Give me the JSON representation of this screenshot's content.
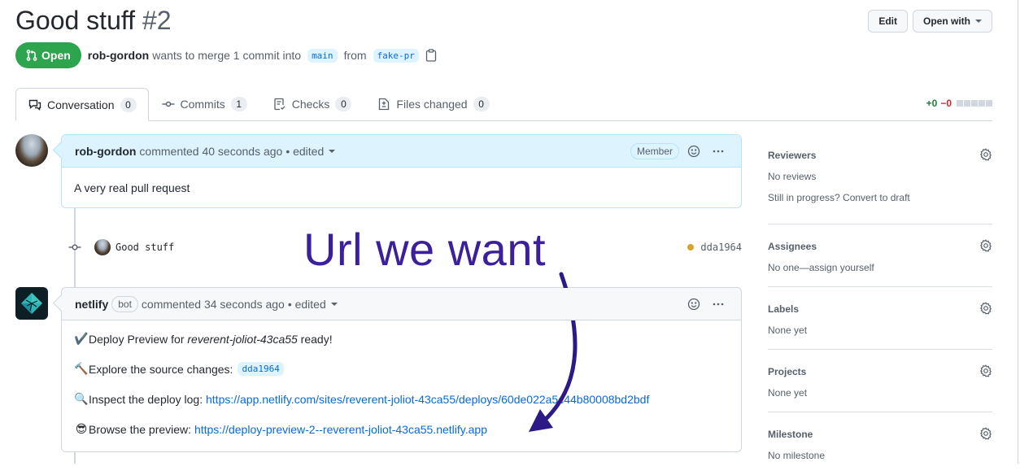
{
  "header": {
    "title": "Good stuff",
    "number": "#2",
    "edit_label": "Edit",
    "open_with_label": "Open with"
  },
  "state": {
    "badge_label": "Open",
    "author": "rob-gordon",
    "merge_text": "wants to merge 1 commit into",
    "base_branch": "main",
    "from_text": "from",
    "head_branch": "fake-pr"
  },
  "tabs": [
    {
      "label": "Conversation",
      "count": "0",
      "icon": "comment-discussion-icon",
      "active": true
    },
    {
      "label": "Commits",
      "count": "1",
      "icon": "git-commit-icon"
    },
    {
      "label": "Checks",
      "count": "0",
      "icon": "checklist-icon"
    },
    {
      "label": "Files changed",
      "count": "0",
      "icon": "file-diff-icon"
    }
  ],
  "diffstat": {
    "additions": "+0",
    "deletions": "−0"
  },
  "comments": [
    {
      "author": "rob-gordon",
      "meta": "commented 40 seconds ago",
      "edited": "• edited",
      "role_badge": "Member",
      "body": "A very real pull request"
    },
    {
      "author": "netlify",
      "bot_badge": "bot",
      "meta": "commented 34 seconds ago",
      "edited": "• edited",
      "lines": [
        {
          "emoji": "✔️",
          "text": "Deploy Preview for ",
          "italic": "reverent-joliot-43ca55",
          "suffix": " ready!"
        },
        {
          "emoji": "🔨",
          "text": "Explore the source changes: ",
          "code": "dda1964"
        },
        {
          "emoji": "🔍",
          "text": "Inspect the deploy log: ",
          "link": "https://app.netlify.com/sites/reverent-joliot-43ca55/deploys/60de022a5c44b80008bd2bdf"
        },
        {
          "emoji": "😎",
          "text": "Browse the preview: ",
          "link": "https://deploy-preview-2--reverent-joliot-43ca55.netlify.app"
        }
      ]
    }
  ],
  "commit": {
    "message": "Good stuff",
    "sha": "dda1964",
    "status_color": "#d4a72c"
  },
  "sidebar": [
    {
      "title": "Reviewers",
      "lines": [
        "No reviews",
        "Still in progress? Convert to draft"
      ]
    },
    {
      "title": "Assignees",
      "lines": [
        "No one—assign yourself"
      ]
    },
    {
      "title": "Labels",
      "lines": [
        "None yet"
      ]
    },
    {
      "title": "Projects",
      "lines": [
        "None yet"
      ]
    },
    {
      "title": "Milestone",
      "lines": [
        "No milestone"
      ]
    }
  ],
  "annotation": {
    "text": "Url we want",
    "color": "#3b1f9c"
  }
}
